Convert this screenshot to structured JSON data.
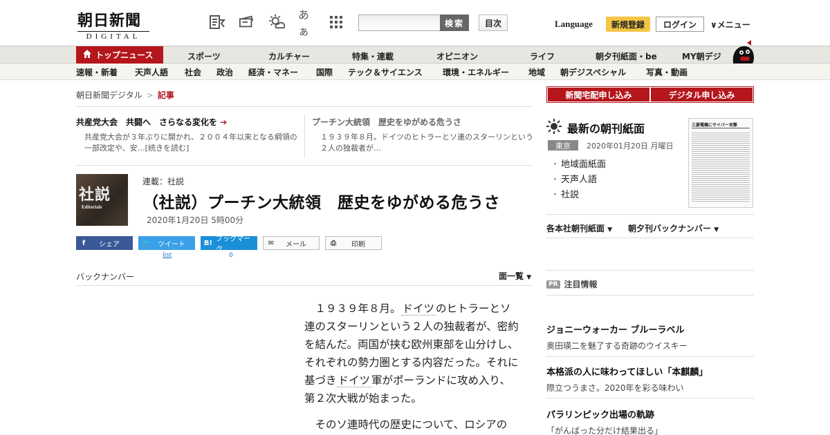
{
  "header": {
    "logo_main": "朝日新聞",
    "logo_sub": "DIGITAL",
    "search_button": "検索",
    "toc_button": "目次",
    "language": "Language",
    "register": "新規登録",
    "login": "ログイン",
    "menu": "メニュー",
    "icons": [
      "news-reader-icon",
      "scrap-icon",
      "weather-icon",
      "font-size-icon",
      "grid-apps-icon"
    ],
    "font_size_glyph": "あぁ"
  },
  "nav_main": {
    "active": "トップニュース",
    "items": [
      "スポーツ",
      "カルチャー",
      "特集・連載",
      "オピニオン",
      "ライフ",
      "朝夕刊紙面・be",
      "MY朝デジ"
    ]
  },
  "nav_sub": {
    "items": [
      "速報・新着",
      "天声人語",
      "社会",
      "政治",
      "経済・マネー",
      "国際",
      "テック＆サイエンス",
      "環境・エネルギー",
      "地域",
      "朝デジスペシャル",
      "写真・動画"
    ]
  },
  "breadcrumb": {
    "home": "朝日新聞デジタル",
    "current": "記事"
  },
  "related": [
    {
      "title": "共産党大会　共闘へ　さらなる変化を",
      "body": "共産党大会が３年ぶりに開かれ、２００４年以来となる綱領の一部改定や、安…[続きを読む]"
    },
    {
      "title": "プーチン大統領　歴史をゆがめる危うさ",
      "body": "１９３９年８月。ドイツのヒトラーとソ連のスターリンという２人の独裁者が…"
    }
  ],
  "article": {
    "thumb_kanji": "社説",
    "thumb_en": "Editorials",
    "series": "連載：社説",
    "title": "（社説）プーチン大統領　歴史をゆがめる危うさ",
    "date": "2020年1月20日 5時00分",
    "share": {
      "facebook": "シェア",
      "twitter": "ツイート",
      "hatena": "ブックマーク",
      "hatena_icon": "B!",
      "mail": "メール",
      "print": "印刷",
      "twitter_count": "list",
      "hatena_count": "0"
    },
    "backnumber": "バックナンバー",
    "page_list": "面一覧",
    "p1_a": "１９３９年８月。",
    "p1_kw1": "ドイツ",
    "p1_b": "のヒトラーとソ連のスターリンという２人の独裁者が、密約を結んだ。両国が挟む欧州東部を山分けし、それぞれの勢力圏とする内容だった。それに基づき",
    "p1_kw2": "ドイツ",
    "p1_c": "軍がポーランドに攻め入り、第２次大戦が始まった。",
    "p2": "そのソ連時代の歴史について、ロシアの"
  },
  "sidebar": {
    "btn_home": "新聞宅配申し込み",
    "btn_digital": "デジタル申し込み",
    "paper_title": "最新の朝刊紙面",
    "city": "東京",
    "paper_date": "2020年01月20日 月曜日",
    "paper_links": [
      "地域面紙面",
      "天声人語",
      "社説"
    ],
    "thumb_headline": "三菱電機にサイバー攻撃",
    "dropdowns": [
      "各本社朝刊紙面",
      "朝夕刊バックナンバー"
    ],
    "pr_badge": "PR",
    "pr_title": "注目情報",
    "ads": [
      {
        "title": "ジョニーウォーカー ブルーラベル",
        "sub": "奥田瑛二を魅了する奇跡のウイスキー"
      },
      {
        "title": "本格派の人に味わってほしい「本麒麟」",
        "sub": "際立つうまさ。2020年を彩る味わい"
      },
      {
        "title": "パラリンピック出場の軌跡",
        "sub": "「がんばった分だけ結果出る」"
      }
    ]
  },
  "colors": {
    "brand_red": "#b4161c",
    "register_yellow": "#f4c647",
    "facebook": "#3b5998",
    "twitter": "#3aa1e8",
    "hatena": "#1a90d8"
  }
}
